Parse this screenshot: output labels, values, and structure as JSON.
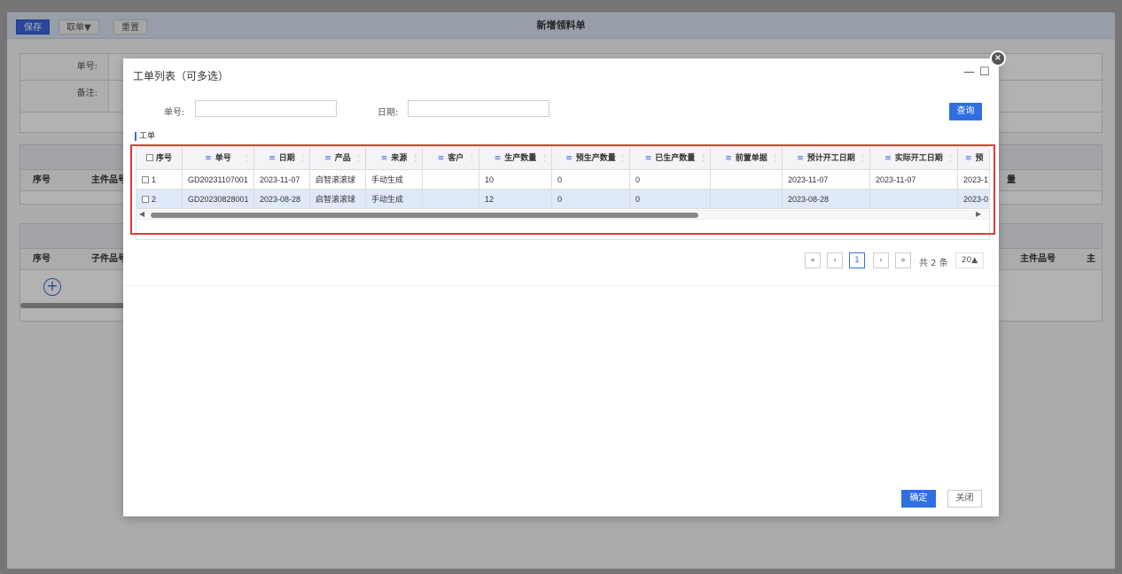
{
  "background": {
    "toolbar": {
      "save_label": "保存",
      "fetch_label": "取单▼",
      "reset_label": "重置"
    },
    "page_title": "新增领料单",
    "form": {
      "order_no_label": "单号:",
      "remark_label": "备注:"
    },
    "grid1": {
      "col_seq": "序号",
      "col_main_part": "主件品号",
      "col_qty_right": "量"
    },
    "grid2": {
      "col_seq": "序号",
      "col_child_part": "子件品号",
      "col_main_part": "主件品号",
      "col_extra": "主"
    }
  },
  "modal": {
    "title": "工单列表（可多选）",
    "minimize_icon": "—",
    "maximize_icon": "☐",
    "close_icon": "×",
    "query": {
      "order_no_label": "单号:",
      "order_no_value": "",
      "date_label": "日期:",
      "date_value": "",
      "query_button": "查询"
    },
    "section_label": "工单",
    "grid": {
      "columns": [
        "序号",
        "单号",
        "日期",
        "产品",
        "来源",
        "客户",
        "生产数量",
        "预生产数量",
        "已生产数量",
        "前置单据",
        "预计开工日期",
        "实际开工日期",
        "预"
      ],
      "rows": [
        {
          "seq": "1",
          "order_no": "GD20231107001",
          "date": "2023-11-07",
          "product": "启智滚滚球",
          "source": "手动生成",
          "customer": "",
          "prod_qty": "10",
          "pre_qty": "0",
          "done_qty": "0",
          "pre_doc": "",
          "plan_start": "2023-11-07",
          "actual_start": "2023-11-07",
          "extra": "2023-1"
        },
        {
          "seq": "2",
          "order_no": "GD20230828001",
          "date": "2023-08-28",
          "product": "启智滚滚球",
          "source": "手动生成",
          "customer": "",
          "prod_qty": "12",
          "pre_qty": "0",
          "done_qty": "0",
          "pre_doc": "",
          "plan_start": "2023-08-28",
          "actual_start": "",
          "extra": "2023-0"
        }
      ],
      "selected_row": 2
    },
    "pager": {
      "first": "«",
      "prev": "‹",
      "current_page": "1",
      "next": "›",
      "last": "»",
      "total": "共 2 条",
      "page_size": "20▲"
    },
    "footer": {
      "ok_label": "确定",
      "close_label": "关闭"
    }
  },
  "colors": {
    "primary": "#2f6fe0",
    "highlight_border": "#e23a3a",
    "selected_row": "#dfe9fa"
  }
}
